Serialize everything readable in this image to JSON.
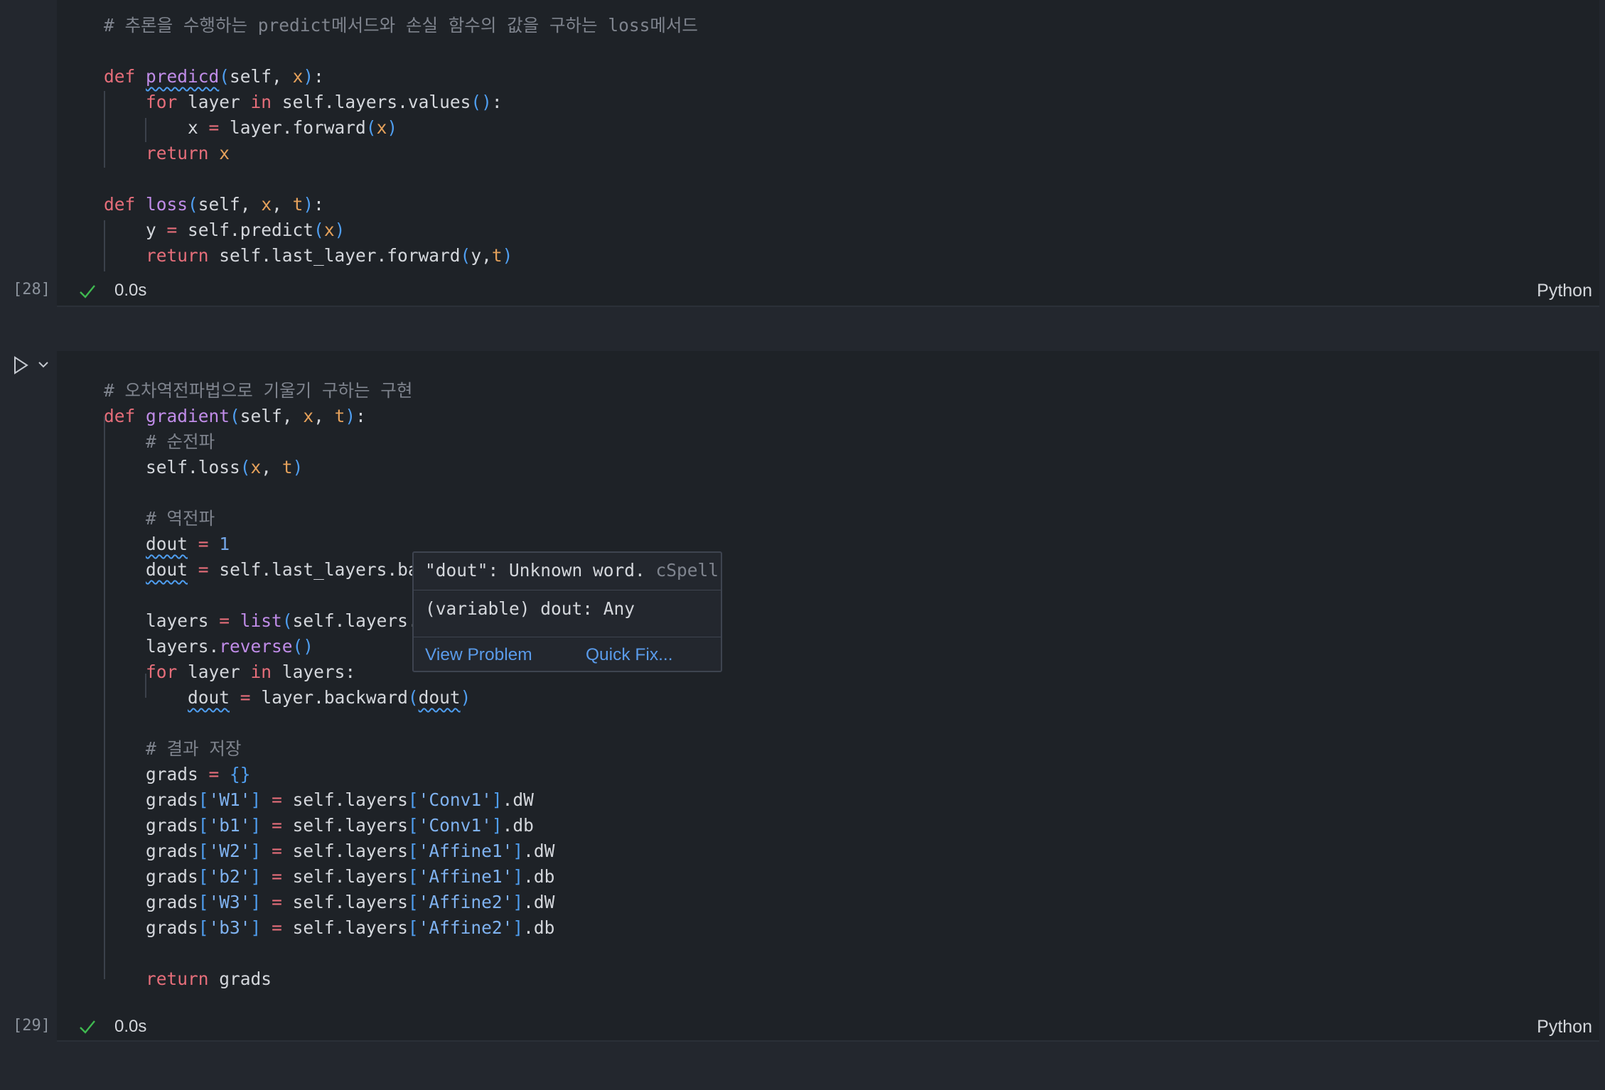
{
  "cell1": {
    "execution_count": "[28]",
    "status_time": "0.0s",
    "language": "Python",
    "lines": [
      [
        {
          "t": "# 추론을 수행하는 predict메서드와 손실 함수의 값을 구하는 loss메서드",
          "c": "comment"
        }
      ],
      [],
      [
        {
          "t": "def ",
          "c": "kw"
        },
        {
          "t": "predicd",
          "c": "fn",
          "squig": true
        },
        {
          "t": "(",
          "c": "paren"
        },
        {
          "t": "self, "
        },
        {
          "t": "x",
          "c": "param"
        },
        {
          "t": ")",
          "c": "paren"
        },
        {
          "t": ":"
        }
      ],
      [
        {
          "t": "    "
        },
        {
          "t": "for",
          "c": "kw"
        },
        {
          "t": " layer "
        },
        {
          "t": "in",
          "c": "kw"
        },
        {
          "t": " self.layers.values"
        },
        {
          "t": "()",
          "c": "paren"
        },
        {
          "t": ":"
        }
      ],
      [
        {
          "t": "        x "
        },
        {
          "t": "=",
          "c": "kw"
        },
        {
          "t": " layer.forward"
        },
        {
          "t": "(",
          "c": "paren"
        },
        {
          "t": "x",
          "c": "param"
        },
        {
          "t": ")",
          "c": "paren"
        }
      ],
      [
        {
          "t": "    "
        },
        {
          "t": "return",
          "c": "kw"
        },
        {
          "t": " "
        },
        {
          "t": "x",
          "c": "param"
        }
      ],
      [],
      [
        {
          "t": "def ",
          "c": "kw"
        },
        {
          "t": "loss",
          "c": "fn"
        },
        {
          "t": "(",
          "c": "paren"
        },
        {
          "t": "self, "
        },
        {
          "t": "x",
          "c": "param"
        },
        {
          "t": ", "
        },
        {
          "t": "t",
          "c": "param"
        },
        {
          "t": ")",
          "c": "paren"
        },
        {
          "t": ":"
        }
      ],
      [
        {
          "t": "    y "
        },
        {
          "t": "=",
          "c": "kw"
        },
        {
          "t": " self.predict"
        },
        {
          "t": "(",
          "c": "paren"
        },
        {
          "t": "x",
          "c": "param"
        },
        {
          "t": ")",
          "c": "paren"
        }
      ],
      [
        {
          "t": "    "
        },
        {
          "t": "return",
          "c": "kw"
        },
        {
          "t": " self.last_layer.forward"
        },
        {
          "t": "(",
          "c": "paren"
        },
        {
          "t": "y,"
        },
        {
          "t": "t",
          "c": "param"
        },
        {
          "t": ")",
          "c": "paren"
        }
      ]
    ]
  },
  "cell2": {
    "execution_count": "[29]",
    "status_time": "0.0s",
    "language": "Python",
    "lines": [
      [
        {
          "t": "# 오차역전파법으로 기울기 구하는 구현",
          "c": "comment"
        }
      ],
      [
        {
          "t": "def ",
          "c": "kw"
        },
        {
          "t": "gradient",
          "c": "fn"
        },
        {
          "t": "(",
          "c": "paren"
        },
        {
          "t": "self, "
        },
        {
          "t": "x",
          "c": "param"
        },
        {
          "t": ", "
        },
        {
          "t": "t",
          "c": "param"
        },
        {
          "t": ")",
          "c": "paren"
        },
        {
          "t": ":"
        }
      ],
      [
        {
          "t": "    "
        },
        {
          "t": "# 순전파",
          "c": "comment"
        }
      ],
      [
        {
          "t": "    self.loss"
        },
        {
          "t": "(",
          "c": "paren"
        },
        {
          "t": "x",
          "c": "param"
        },
        {
          "t": ", "
        },
        {
          "t": "t",
          "c": "param"
        },
        {
          "t": ")",
          "c": "paren"
        }
      ],
      [],
      [
        {
          "t": "    "
        },
        {
          "t": "# 역전파",
          "c": "comment"
        }
      ],
      [
        {
          "t": "    "
        },
        {
          "t": "dout",
          "squig": true
        },
        {
          "t": " "
        },
        {
          "t": "=",
          "c": "kw"
        },
        {
          "t": " "
        },
        {
          "t": "1",
          "c": "num"
        }
      ],
      [
        {
          "t": "    "
        },
        {
          "t": "dout",
          "squig": true
        },
        {
          "t": " "
        },
        {
          "t": "=",
          "c": "kw"
        },
        {
          "t": " self.last_layers.ba"
        }
      ],
      [],
      [
        {
          "t": "    layers "
        },
        {
          "t": "=",
          "c": "kw"
        },
        {
          "t": " "
        },
        {
          "t": "list",
          "c": "fn"
        },
        {
          "t": "(",
          "c": "paren"
        },
        {
          "t": "self.layers."
        }
      ],
      [
        {
          "t": "    layers."
        },
        {
          "t": "reverse",
          "c": "fn"
        },
        {
          "t": "()",
          "c": "paren"
        }
      ],
      [
        {
          "t": "    "
        },
        {
          "t": "for",
          "c": "kw"
        },
        {
          "t": " layer "
        },
        {
          "t": "in",
          "c": "kw"
        },
        {
          "t": " layers:"
        }
      ],
      [
        {
          "t": "        "
        },
        {
          "t": "dout",
          "squig": true
        },
        {
          "t": " "
        },
        {
          "t": "=",
          "c": "kw"
        },
        {
          "t": " layer.backward"
        },
        {
          "t": "(",
          "c": "paren"
        },
        {
          "t": "dout",
          "squig": true
        },
        {
          "t": ")",
          "c": "paren"
        }
      ],
      [],
      [
        {
          "t": "    "
        },
        {
          "t": "# 결과 저장",
          "c": "comment"
        }
      ],
      [
        {
          "t": "    grads "
        },
        {
          "t": "=",
          "c": "kw"
        },
        {
          "t": " "
        },
        {
          "t": "{}",
          "c": "paren"
        }
      ],
      [
        {
          "t": "    grads"
        },
        {
          "t": "[",
          "c": "paren"
        },
        {
          "t": "'W1'",
          "c": "str"
        },
        {
          "t": "]",
          "c": "paren"
        },
        {
          "t": " "
        },
        {
          "t": "=",
          "c": "kw"
        },
        {
          "t": " self.layers"
        },
        {
          "t": "[",
          "c": "paren"
        },
        {
          "t": "'Conv1'",
          "c": "str"
        },
        {
          "t": "]",
          "c": "paren"
        },
        {
          "t": ".dW"
        }
      ],
      [
        {
          "t": "    grads"
        },
        {
          "t": "[",
          "c": "paren"
        },
        {
          "t": "'b1'",
          "c": "str"
        },
        {
          "t": "]",
          "c": "paren"
        },
        {
          "t": " "
        },
        {
          "t": "=",
          "c": "kw"
        },
        {
          "t": " self.layers"
        },
        {
          "t": "[",
          "c": "paren"
        },
        {
          "t": "'Conv1'",
          "c": "str"
        },
        {
          "t": "]",
          "c": "paren"
        },
        {
          "t": ".db"
        }
      ],
      [
        {
          "t": "    grads"
        },
        {
          "t": "[",
          "c": "paren"
        },
        {
          "t": "'W2'",
          "c": "str"
        },
        {
          "t": "]",
          "c": "paren"
        },
        {
          "t": " "
        },
        {
          "t": "=",
          "c": "kw"
        },
        {
          "t": " self.layers"
        },
        {
          "t": "[",
          "c": "paren"
        },
        {
          "t": "'Affine1'",
          "c": "str"
        },
        {
          "t": "]",
          "c": "paren"
        },
        {
          "t": ".dW"
        }
      ],
      [
        {
          "t": "    grads"
        },
        {
          "t": "[",
          "c": "paren"
        },
        {
          "t": "'b2'",
          "c": "str"
        },
        {
          "t": "]",
          "c": "paren"
        },
        {
          "t": " "
        },
        {
          "t": "=",
          "c": "kw"
        },
        {
          "t": " self.layers"
        },
        {
          "t": "[",
          "c": "paren"
        },
        {
          "t": "'Affine1'",
          "c": "str"
        },
        {
          "t": "]",
          "c": "paren"
        },
        {
          "t": ".db"
        }
      ],
      [
        {
          "t": "    grads"
        },
        {
          "t": "[",
          "c": "paren"
        },
        {
          "t": "'W3'",
          "c": "str"
        },
        {
          "t": "]",
          "c": "paren"
        },
        {
          "t": " "
        },
        {
          "t": "=",
          "c": "kw"
        },
        {
          "t": " self.layers"
        },
        {
          "t": "[",
          "c": "paren"
        },
        {
          "t": "'Affine2'",
          "c": "str"
        },
        {
          "t": "]",
          "c": "paren"
        },
        {
          "t": ".dW"
        }
      ],
      [
        {
          "t": "    grads"
        },
        {
          "t": "[",
          "c": "paren"
        },
        {
          "t": "'b3'",
          "c": "str"
        },
        {
          "t": "]",
          "c": "paren"
        },
        {
          "t": " "
        },
        {
          "t": "=",
          "c": "kw"
        },
        {
          "t": " self.layers"
        },
        {
          "t": "[",
          "c": "paren"
        },
        {
          "t": "'Affine2'",
          "c": "str"
        },
        {
          "t": "]",
          "c": "paren"
        },
        {
          "t": ".db"
        }
      ],
      [],
      [
        {
          "t": "    "
        },
        {
          "t": "return",
          "c": "kw"
        },
        {
          "t": " grads"
        }
      ]
    ]
  },
  "hover": {
    "message_quoted": "\"dout\": Unknown word.",
    "message_source": "cSpell",
    "type_info": "(variable) dout: Any",
    "view_problem": "View Problem",
    "quick_fix": "Quick Fix..."
  },
  "icons": {
    "run": "play-icon",
    "collapse": "chevron-down-icon",
    "success": "check-icon"
  },
  "colors": {
    "background": "#23272e",
    "cell_background": "#1e2227",
    "keyword": "#e66e7a",
    "function": "#c08ce8",
    "parameter": "#e5a15b",
    "bracket": "#4f9ef0",
    "comment": "#7f848e",
    "success": "#3fb950",
    "link": "#5a9bea"
  }
}
